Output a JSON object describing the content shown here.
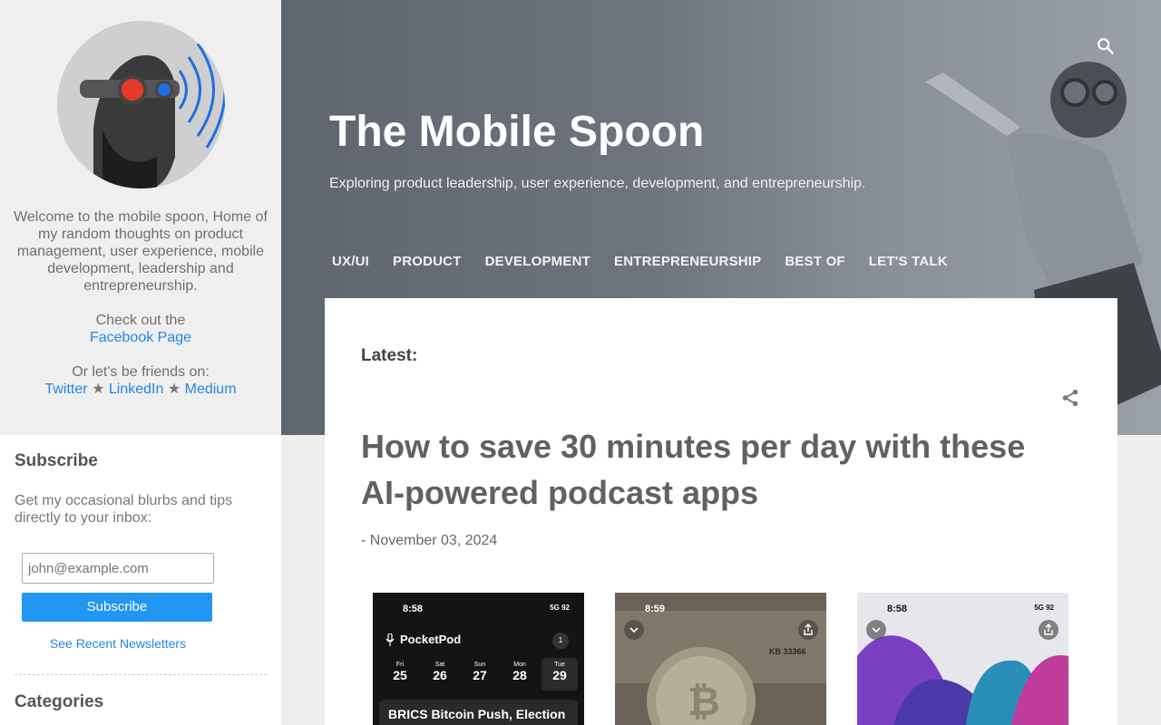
{
  "sidebar": {
    "welcome_line": "Welcome to the mobile spoon, Home of my random thoughts on product management, user experience, mobile development, leadership and entrepreneurship.",
    "check_out": "Check out the",
    "facebook_link": "Facebook Page",
    "friends_text": "Or let's be friends on:",
    "twitter_link": "Twitter",
    "linkedin_link": "LinkedIn",
    "medium_link": "Medium",
    "separator": "★",
    "subscribe": {
      "title": "Subscribe",
      "description": "Get my occasional blurbs and tips directly to your inbox:",
      "email_placeholder": "john@example.com",
      "button": "Subscribe",
      "recent_link": "See Recent Newsletters"
    },
    "categories_title": "Categories"
  },
  "header": {
    "title": "The Mobile Spoon",
    "description": "Exploring product leadership, user experience, development, and entrepreneurship.",
    "nav": [
      "UX/UI",
      "PRODUCT",
      "DEVELOPMENT",
      "ENTREPRENEURSHIP",
      "BEST OF",
      "LET'S TALK"
    ]
  },
  "main": {
    "latest_label": "Latest:",
    "post_title": "How to save 30 minutes per day with these AI-powered podcast apps",
    "post_date": "- November 03, 2024"
  },
  "thumbnails": {
    "t1": {
      "time": "8:58",
      "status": "5G 92",
      "app_name": "PocketPod",
      "badge": "1",
      "days": [
        {
          "name": "Fri",
          "date": "25"
        },
        {
          "name": "Sat",
          "date": "26"
        },
        {
          "name": "Sun",
          "date": "27"
        },
        {
          "name": "Mon",
          "date": "28"
        },
        {
          "name": "Tue",
          "date": "29"
        }
      ],
      "card_title": "BRICS Bitcoin Push, Election"
    },
    "t2": {
      "time": "8:59",
      "bill_text": "KB 33366"
    },
    "t3": {
      "time": "8:58",
      "status": "5G 92"
    }
  },
  "colors": {
    "link": "#2187e7",
    "button": "#2196f3"
  }
}
